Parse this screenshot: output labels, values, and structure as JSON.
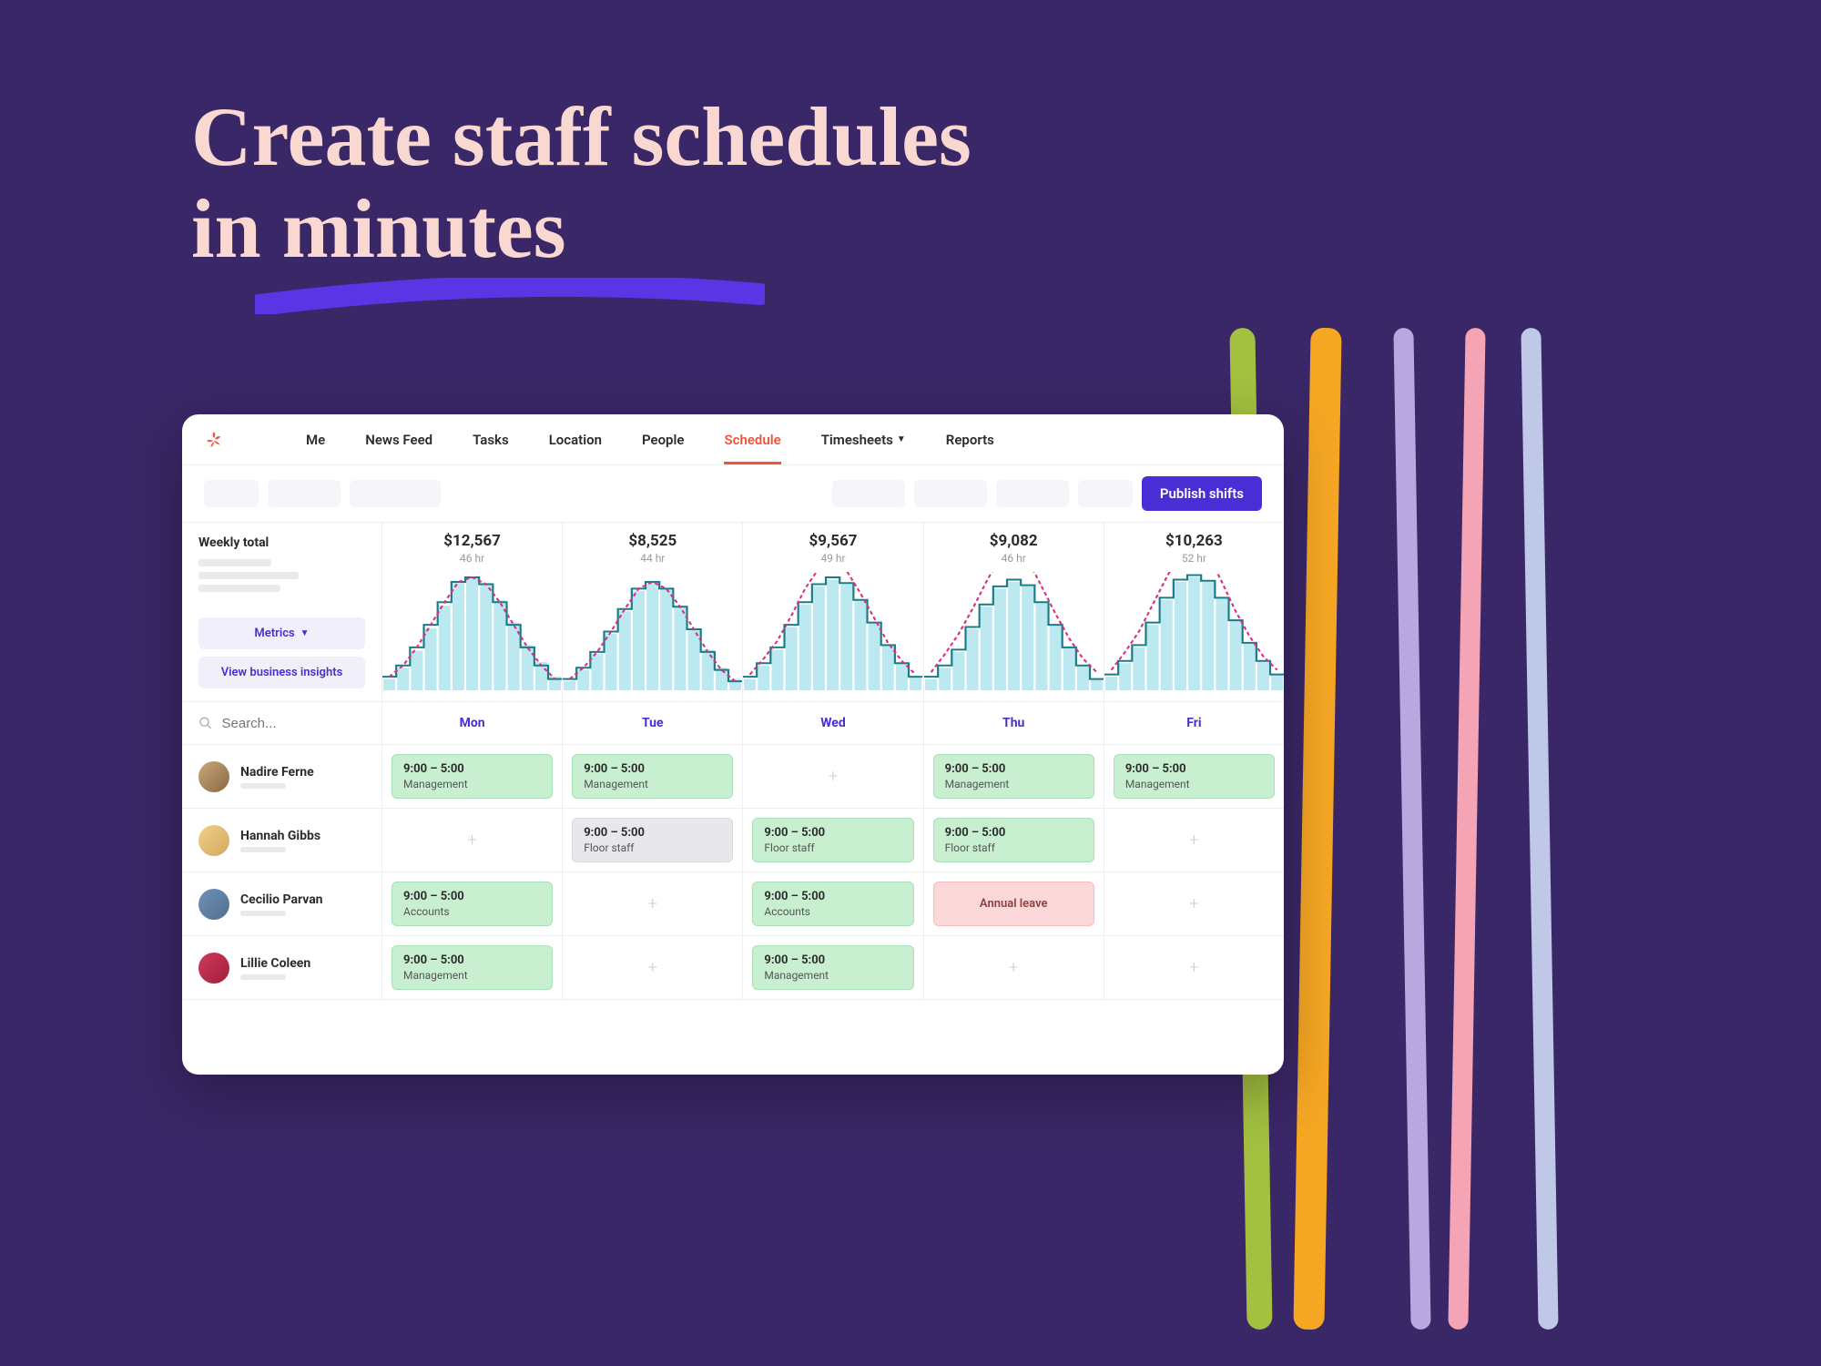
{
  "hero": {
    "line1": "Create staff schedules",
    "line2": "in minutes"
  },
  "nav": {
    "items": [
      "Me",
      "News Feed",
      "Tasks",
      "Location",
      "People",
      "Schedule",
      "Timesheets",
      "Reports"
    ],
    "active": "Schedule",
    "dropdown_on": "Timesheets"
  },
  "toolbar": {
    "publish_label": "Publish shifts"
  },
  "weekly": {
    "title": "Weekly total",
    "metrics_label": "Metrics",
    "insights_label": "View business insights"
  },
  "days": [
    {
      "short": "Mon",
      "amount": "$12,567",
      "hours": "46 hr"
    },
    {
      "short": "Tue",
      "amount": "$8,525",
      "hours": "44 hr"
    },
    {
      "short": "Wed",
      "amount": "$9,567",
      "hours": "49 hr"
    },
    {
      "short": "Thu",
      "amount": "$9,082",
      "hours": "46 hr"
    },
    {
      "short": "Fri",
      "amount": "$10,263",
      "hours": "52 hr"
    }
  ],
  "search": {
    "placeholder": "Search..."
  },
  "shift_defaults": {
    "time": "9:00 – 5:00"
  },
  "roles": {
    "mgmt": "Management",
    "floor": "Floor staff",
    "acct": "Accounts"
  },
  "leave_label": "Annual leave",
  "staff": [
    {
      "name": "Nadire Ferne",
      "shifts": [
        {
          "type": "green",
          "role": "mgmt"
        },
        {
          "type": "green",
          "role": "mgmt"
        },
        {
          "type": "plus"
        },
        {
          "type": "green",
          "role": "mgmt"
        },
        {
          "type": "green",
          "role": "mgmt"
        }
      ]
    },
    {
      "name": "Hannah Gibbs",
      "shifts": [
        {
          "type": "plus"
        },
        {
          "type": "gray",
          "role": "floor"
        },
        {
          "type": "green",
          "role": "floor"
        },
        {
          "type": "green",
          "role": "floor"
        },
        {
          "type": "plus"
        }
      ]
    },
    {
      "name": "Cecilio Parvan",
      "shifts": [
        {
          "type": "green",
          "role": "acct"
        },
        {
          "type": "plus"
        },
        {
          "type": "green",
          "role": "acct"
        },
        {
          "type": "leave"
        },
        {
          "type": "plus"
        }
      ]
    },
    {
      "name": "Lillie Coleen",
      "shifts": [
        {
          "type": "green",
          "role": "mgmt"
        },
        {
          "type": "plus"
        },
        {
          "type": "green",
          "role": "mgmt"
        },
        {
          "type": "plus"
        },
        {
          "type": "plus"
        }
      ]
    }
  ],
  "chart_data": {
    "type": "bar",
    "note": "Mini daily demand charts — one per weekday. Values are estimated relative heights (0-100) read from stepped bars; solid line tracks bars, dashed line is forecast.",
    "days": [
      {
        "label": "Mon",
        "amount": 12567,
        "hours": 46,
        "bars": [
          10,
          20,
          35,
          55,
          75,
          95,
          100,
          95,
          80,
          60,
          40,
          25,
          12
        ],
        "solid": [
          12,
          22,
          38,
          58,
          78,
          96,
          100,
          94,
          78,
          58,
          38,
          22,
          10
        ],
        "dashed": [
          12,
          22,
          38,
          58,
          78,
          96,
          100,
          94,
          78,
          58,
          38,
          22,
          10
        ]
      },
      {
        "label": "Tue",
        "amount": 8525,
        "hours": 44,
        "bars": [
          8,
          18,
          32,
          50,
          70,
          88,
          95,
          90,
          75,
          55,
          36,
          20,
          10
        ],
        "solid": [
          10,
          20,
          34,
          52,
          72,
          90,
          96,
          90,
          74,
          54,
          34,
          18,
          8
        ],
        "dashed": [
          10,
          20,
          34,
          52,
          72,
          90,
          96,
          90,
          74,
          54,
          34,
          18,
          8
        ]
      },
      {
        "label": "Wed",
        "amount": 9567,
        "hours": 49,
        "bars": [
          10,
          22,
          36,
          56,
          76,
          92,
          98,
          94,
          80,
          60,
          40,
          24,
          12
        ],
        "solid": [
          12,
          24,
          38,
          58,
          78,
          94,
          100,
          95,
          80,
          60,
          40,
          24,
          12
        ],
        "dashed": [
          14,
          28,
          44,
          66,
          90,
          108,
          112,
          106,
          86,
          64,
          42,
          26,
          14
        ]
      },
      {
        "label": "Thu",
        "amount": 9082,
        "hours": 46,
        "bars": [
          10,
          20,
          34,
          54,
          74,
          90,
          96,
          92,
          78,
          58,
          38,
          22,
          10
        ],
        "solid": [
          12,
          22,
          36,
          56,
          76,
          92,
          98,
          93,
          78,
          58,
          38,
          22,
          10
        ],
        "dashed": [
          16,
          32,
          50,
          72,
          96,
          118,
          124,
          116,
          92,
          68,
          46,
          28,
          16
        ]
      },
      {
        "label": "Fri",
        "amount": 10263,
        "hours": 52,
        "bars": [
          12,
          24,
          38,
          58,
          80,
          96,
          100,
          96,
          82,
          62,
          42,
          26,
          14
        ],
        "solid": [
          14,
          26,
          40,
          60,
          82,
          98,
          102,
          97,
          82,
          62,
          42,
          26,
          14
        ],
        "dashed": [
          18,
          34,
          52,
          76,
          100,
          122,
          128,
          120,
          96,
          70,
          48,
          30,
          18
        ]
      }
    ]
  }
}
